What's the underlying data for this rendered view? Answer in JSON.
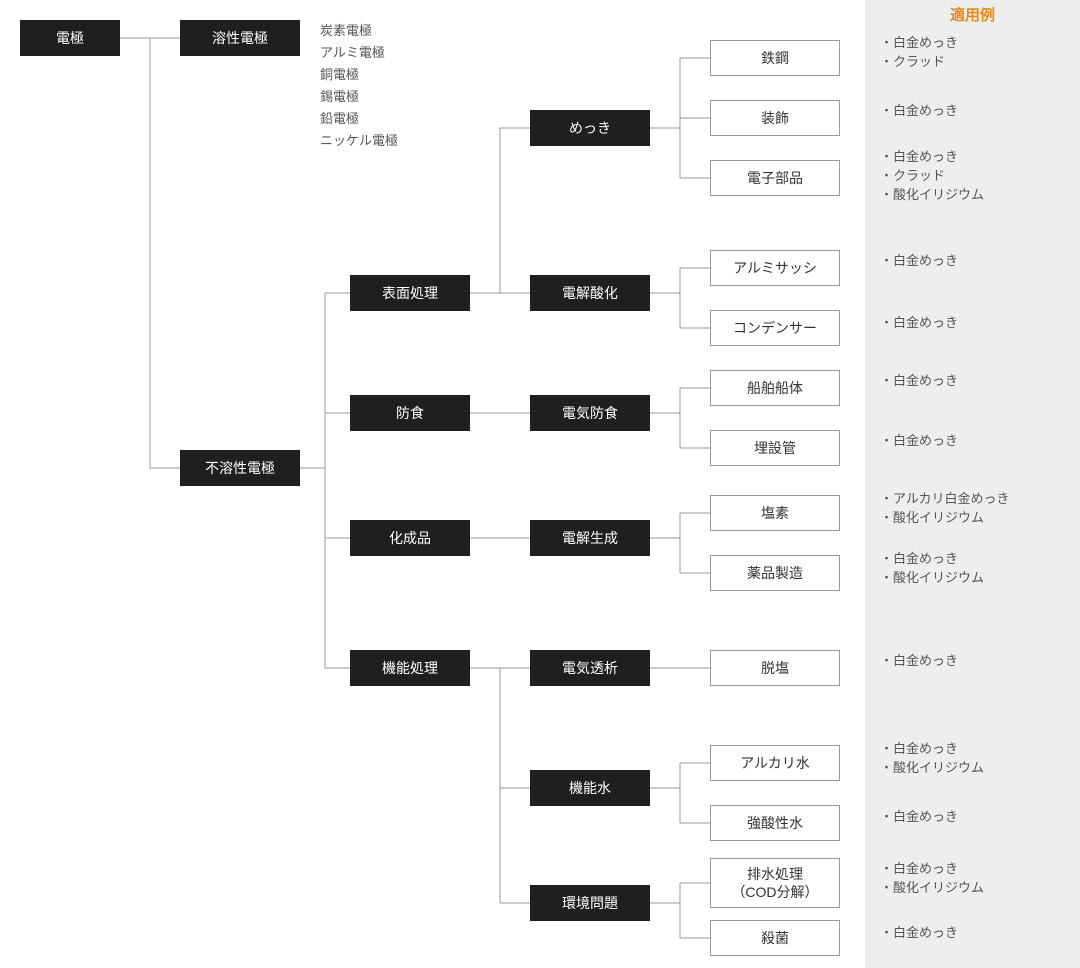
{
  "header": "適用例",
  "root": "電極",
  "soluble": {
    "label": "溶性電極",
    "items": [
      "炭素電極",
      "アルミ電極",
      "銅電極",
      "錫電極",
      "鉛電極",
      "ニッケル電極"
    ]
  },
  "insoluble": "不溶性電極",
  "categories": {
    "surface": "表面処理",
    "corrosion": "防食",
    "chemical": "化成品",
    "functional": "機能処理"
  },
  "methods": {
    "plating": "めっき",
    "anodic": "電解酸化",
    "cathodic": "電気防食",
    "electrogen": "電解生成",
    "dialysis": "電気透析",
    "funcwater": "機能水",
    "env": "環境問題"
  },
  "leaves": {
    "iron_copper": "鉄鋼",
    "decoration": "装飾",
    "electronic": "電子部品",
    "sash": "アルミサッシ",
    "capacitor": "コンデンサー",
    "hull": "船舶船体",
    "pipe": "埋設管",
    "chlorine": "塩素",
    "pharma": "薬品製造",
    "desalt": "脱塩",
    "alkaline": "アルカリ水",
    "strongacid": "強酸性水",
    "wastewater": "排水処理\n（COD分解）",
    "sterilize": "殺菌"
  },
  "apps": {
    "iron_copper": "・白金めっき\n・クラッド",
    "decoration": "・白金めっき",
    "electronic": "・白金めっき\n・クラッド\n・酸化イリジウム",
    "sash": "・白金めっき",
    "capacitor": "・白金めっき",
    "hull": "・白金めっき",
    "pipe": "・白金めっき",
    "chlorine": "・アルカリ白金めっき\n・酸化イリジウム",
    "pharma": "・白金めっき\n・酸化イリジウム",
    "desalt": "・白金めっき",
    "alkaline": "・白金めっき\n・酸化イリジウム",
    "strongacid": "・白金めっき",
    "wastewater": "・白金めっき\n・酸化イリジウム",
    "sterilize": "・白金めっき"
  }
}
